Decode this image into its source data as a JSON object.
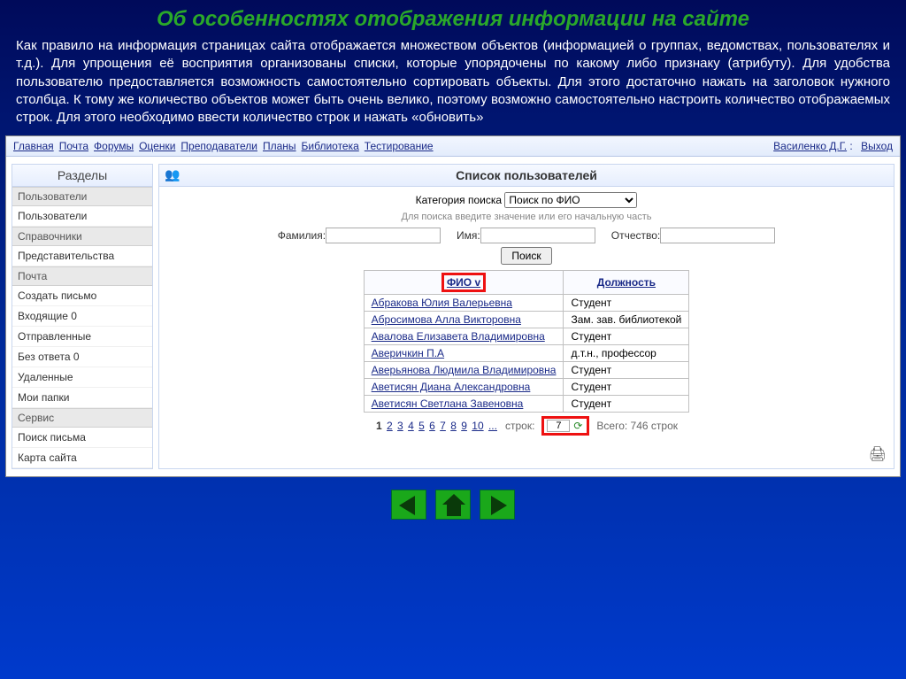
{
  "slide": {
    "title": "Об особенностях отображения информации на сайте",
    "paragraph": "Как правило на информация страницах сайта отображается множеством объектов (информацией о группах, ведомствах, пользователях и т.д.). Для упрощения её восприятия организованы списки, которые упорядочены по какому либо признаку (атрибуту). Для удобства пользователю предоставляется возможность самостоятельно сортировать объекты. Для этого достаточно нажать на заголовок нужного столбца. К тому же количество объектов может быть очень велико, поэтому возможно самостоятельно настроить количество отображаемых строк. Для этого необходимо ввести количество строк и нажать «обновить»"
  },
  "topnav": {
    "links": [
      "Главная",
      "Почта",
      "Форумы",
      "Оценки",
      "Преподаватели",
      "Планы",
      "Библиотека",
      "Тестирование"
    ],
    "user": "Василенко Д.Г.",
    "sep": " : ",
    "logout": "Выход"
  },
  "sidebar": {
    "title": "Разделы",
    "groups": [
      {
        "label": "Пользователи",
        "items": [
          "Пользователи"
        ]
      },
      {
        "label": "Справочники",
        "items": [
          "Представительства"
        ]
      },
      {
        "label": "Почта",
        "items": [
          "Создать письмо",
          "Входящие 0",
          "Отправленные",
          "Без ответа 0",
          "Удаленные",
          "Мои папки"
        ]
      },
      {
        "label": "Сервис",
        "items": [
          "Поиск письма",
          "Карта сайта"
        ]
      }
    ]
  },
  "main": {
    "title": "Список пользователей",
    "search_cat_label": "Категория поиска",
    "search_cat_value": "Поиск по ФИО",
    "hint": "Для поиска введите значение или его начальную часть",
    "fields": {
      "lastname": "Фамилия:",
      "firstname": "Имя:",
      "patronymic": "Отчество:"
    },
    "search_btn": "Поиск",
    "columns": {
      "fio": "ФИО v",
      "position": "Должность"
    },
    "rows": [
      {
        "fio": "Абракова Юлия Валерьевна",
        "position": "Студент"
      },
      {
        "fio": "Абросимова Алла Викторовна",
        "position": "Зам. зав. библиотекой"
      },
      {
        "fio": "Авалова Елизавета Владимировна",
        "position": "Студент"
      },
      {
        "fio": "Аверичкин П.А",
        "position": "д.т.н., профессор"
      },
      {
        "fio": "Аверьянова Людмила Владимировна",
        "position": "Студент"
      },
      {
        "fio": "Аветисян Диана Александровна",
        "position": "Студент"
      },
      {
        "fio": "Аветисян Светлана Завеновна",
        "position": "Студент"
      }
    ],
    "pager": {
      "pages": [
        "1",
        "2",
        "3",
        "4",
        "5",
        "6",
        "7",
        "8",
        "9",
        "10",
        "..."
      ],
      "current": "1",
      "rows_label": "строк:",
      "rows_value": "7",
      "total_label": "Всего: 746 строк"
    }
  }
}
